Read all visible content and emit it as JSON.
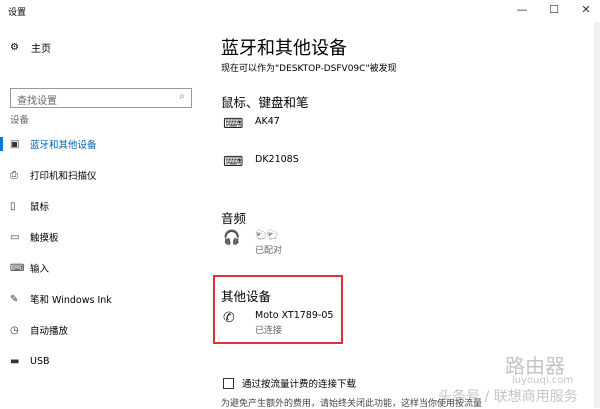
{
  "window": {
    "title": "设置",
    "minimize": "—",
    "maximize": "☐",
    "close": "✕"
  },
  "sidebar": {
    "home": "主页",
    "search_placeholder": "查找设置",
    "section": "设备",
    "items": [
      {
        "label": "蓝牙和其他设备",
        "icon": "bluetooth-devices-icon"
      },
      {
        "label": "打印机和扫描仪",
        "icon": "printer-icon"
      },
      {
        "label": "鼠标",
        "icon": "mouse-icon"
      },
      {
        "label": "触摸板",
        "icon": "touchpad-icon"
      },
      {
        "label": "输入",
        "icon": "keyboard-icon"
      },
      {
        "label": "笔和 Windows Ink",
        "icon": "pen-icon"
      },
      {
        "label": "自动播放",
        "icon": "autoplay-icon"
      },
      {
        "label": "USB",
        "icon": "usb-icon"
      }
    ]
  },
  "main": {
    "title": "蓝牙和其他设备",
    "discoverable": "现在可以作为\"DESKTOP-DSFV09C\"被发现",
    "mouse_section": "鼠标、键盘和笔",
    "keyboards": [
      {
        "name": "AK47"
      },
      {
        "name": "DK2108S"
      }
    ],
    "audio_section": "音频",
    "audio_device": {
      "name": "🐑🐑",
      "status": "已配对"
    },
    "other_section": "其他设备",
    "other_device": {
      "name": "Moto XT1789-05",
      "status": "已连接"
    },
    "metered_label": "通过按流量计费的连接下载",
    "metered_note": "为避免产生额外的费用，请始终关闭此功能，这样当你使用按流量"
  },
  "watermark": {
    "brand": "路由器",
    "site": "luyouqi.com",
    "source": "头条号 / 联想商用服务"
  }
}
